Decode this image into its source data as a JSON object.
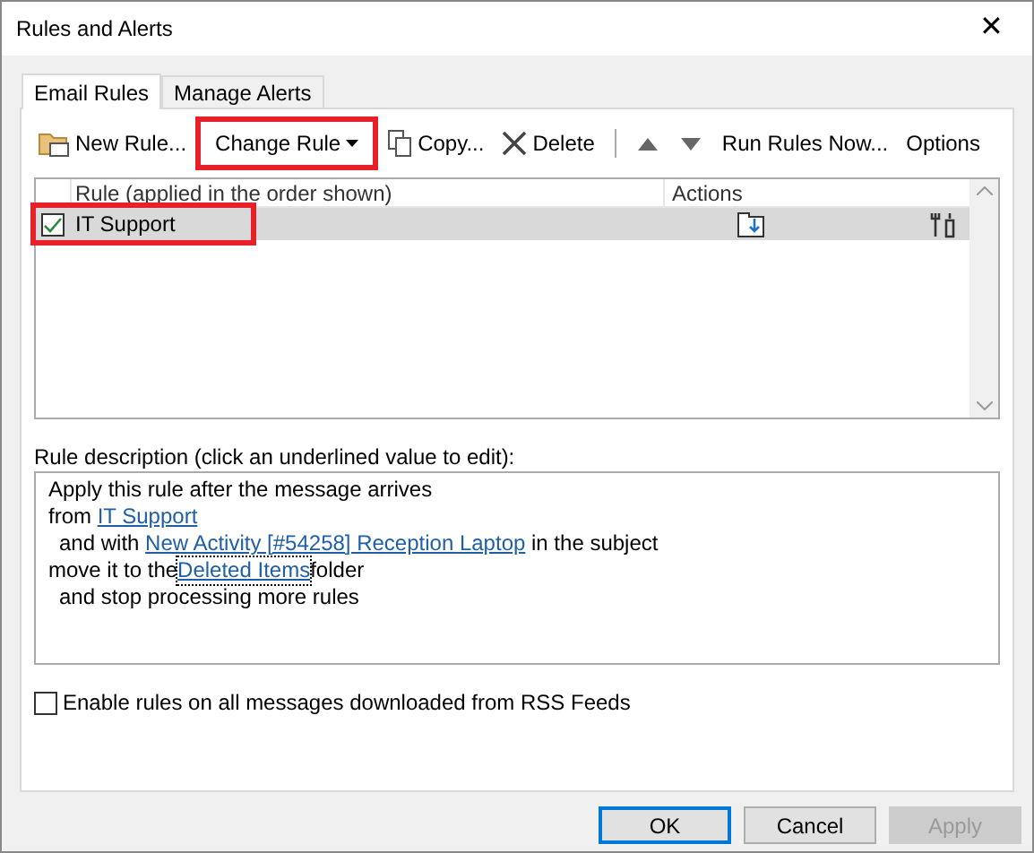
{
  "window": {
    "title": "Rules and Alerts",
    "close": "✕"
  },
  "tabs": [
    {
      "label": "Email Rules",
      "selected": true
    },
    {
      "label": "Manage Alerts",
      "selected": false
    }
  ],
  "toolbar": [
    {
      "kind": "new",
      "label": "New Rule...",
      "highlighted": false
    },
    {
      "kind": "menu",
      "label": "Change Rule",
      "highlighted": true
    },
    {
      "kind": "copy",
      "label": "Copy...",
      "highlighted": false
    },
    {
      "kind": "delete",
      "label": "Delete",
      "highlighted": false
    },
    {
      "kind": "separator"
    },
    {
      "kind": "up"
    },
    {
      "kind": "down"
    },
    {
      "kind": "text",
      "label": "Run Rules Now...",
      "highlighted": false
    },
    {
      "kind": "text",
      "label": "Options",
      "highlighted": false
    }
  ],
  "rules_table": {
    "columns": [
      "Rule (applied in the order shown)",
      "Actions"
    ],
    "rows": [
      {
        "name": "IT Support",
        "checked": true,
        "selected": true,
        "highlighted": true
      }
    ]
  },
  "description": {
    "label": "Rule description (click an underlined value to edit):",
    "lines": [
      {
        "indent": false,
        "parts": [
          {
            "text": "Apply this rule after the message arrives",
            "link": false
          }
        ]
      },
      {
        "indent": false,
        "parts": [
          {
            "text": "from ",
            "link": false
          },
          {
            "text": "IT Support",
            "link": true,
            "focused": false
          }
        ]
      },
      {
        "indent": true,
        "parts": [
          {
            "text": "and with ",
            "link": false
          },
          {
            "text": "New Activity [#54258] Reception Laptop",
            "link": true,
            "focused": false
          },
          {
            "text": " in the subject",
            "link": false
          }
        ]
      },
      {
        "indent": false,
        "parts": [
          {
            "text": "move it to the",
            "link": false
          },
          {
            "text": "Deleted Items",
            "link": true,
            "focused": true
          },
          {
            "text": "folder",
            "link": false
          }
        ]
      },
      {
        "indent": true,
        "parts": [
          {
            "text": "and stop processing more rules",
            "link": false
          }
        ]
      }
    ]
  },
  "rss_option": {
    "label": "Enable rules on all messages downloaded from RSS Feeds",
    "checked": false
  },
  "buttons": [
    {
      "label": "OK",
      "default": true,
      "disabled": false
    },
    {
      "label": "Cancel",
      "default": false,
      "disabled": false
    },
    {
      "label": "Apply",
      "default": false,
      "disabled": true
    }
  ]
}
